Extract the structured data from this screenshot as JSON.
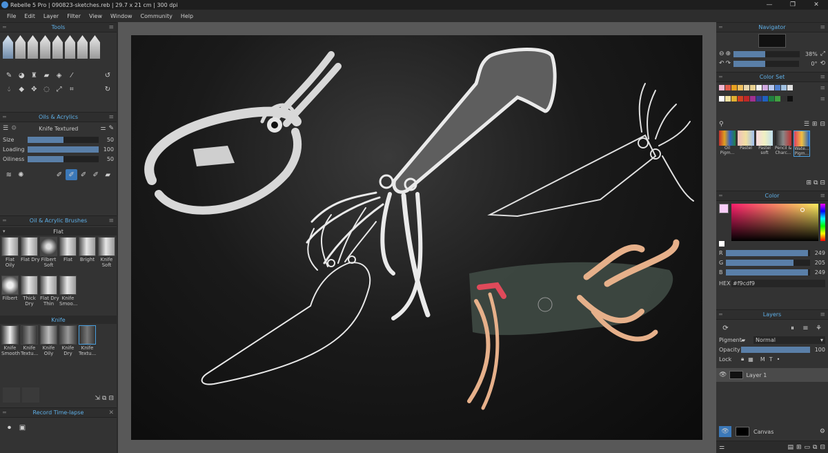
{
  "window": {
    "title": "Rebelle 5 Pro | 090823-sketches.reb | 29.7 x 21 cm | 300 dpi",
    "controls": [
      "—",
      "❐",
      "✕"
    ]
  },
  "menu": [
    "File",
    "Edit",
    "Layer",
    "Filter",
    "View",
    "Window",
    "Community",
    "Help"
  ],
  "tools_panel": {
    "title": "Tools"
  },
  "oils_panel": {
    "title": "Oils & Acrylics",
    "brush_name": "Knife Textured",
    "sliders": [
      {
        "label": "Size",
        "value": "50",
        "fill": 0.5
      },
      {
        "label": "Loading",
        "value": "100",
        "fill": 1.0
      },
      {
        "label": "Oiliness",
        "value": "50",
        "fill": 0.5
      }
    ]
  },
  "brushes_panel": {
    "title": "Oil & Acrylic Brushes",
    "flat_group": "Flat",
    "flat_row1": [
      "Flat\nOily",
      "Flat Dry",
      "Filbert\nSoft",
      "Flat",
      "Bright"
    ],
    "flat_row2": [
      "Knife\nSoft",
      "Filbert",
      "Thick\nDry",
      "Flat Dry\nThin",
      "Knife\nSmoo..."
    ],
    "knife_group": "Knife",
    "knife_row": [
      "Knife\nSmooth",
      "Knife\nTextu...",
      "Knife\nOily",
      "Knife\nDry",
      "Knife\nTextu..."
    ]
  },
  "timelapse_panel": {
    "title": "Record Time-lapse"
  },
  "navigator": {
    "title": "Navigator",
    "zoom": "38%",
    "rotation": "0°"
  },
  "color_set": {
    "title": "Color Set",
    "row1": [
      "#f2b8d2",
      "#e05a4a",
      "#e8a020",
      "#f0c060",
      "#e8d8b0",
      "#e8d090",
      "#f0f0f0",
      "#d0a8e0",
      "#b8c8f0",
      "#5080d0",
      "#a0c0e0",
      "#e0e0e0"
    ],
    "row2": [
      "#ffffff",
      "#f0e0a0",
      "#e0b030",
      "#d04020",
      "#c02828",
      "#a03090",
      "#304090",
      "#2060c0",
      "#208040",
      "#40a040",
      "#303030",
      "#101010"
    ],
    "sets": [
      "Oil\nPigm...",
      "Pastel",
      "Pastel\nsoft",
      "Pencil &\nCharc...",
      "Wate...\nPigm..."
    ]
  },
  "color_panel": {
    "title": "Color",
    "channels": [
      {
        "label": "R",
        "value": "249",
        "fill": 0.976
      },
      {
        "label": "G",
        "value": "205",
        "fill": 0.804
      },
      {
        "label": "B",
        "value": "249",
        "fill": 0.976
      }
    ],
    "hex_label": "HEX",
    "hex_value": "#f9cdf9"
  },
  "layers_panel": {
    "title": "Layers",
    "pigment_label": "Pigment",
    "blend_mode": "Normal",
    "opacity_label": "Opacity",
    "opacity_value": "100",
    "lock_label": "Lock",
    "layer_name": "Layer 1",
    "canvas_label": "Canvas"
  }
}
